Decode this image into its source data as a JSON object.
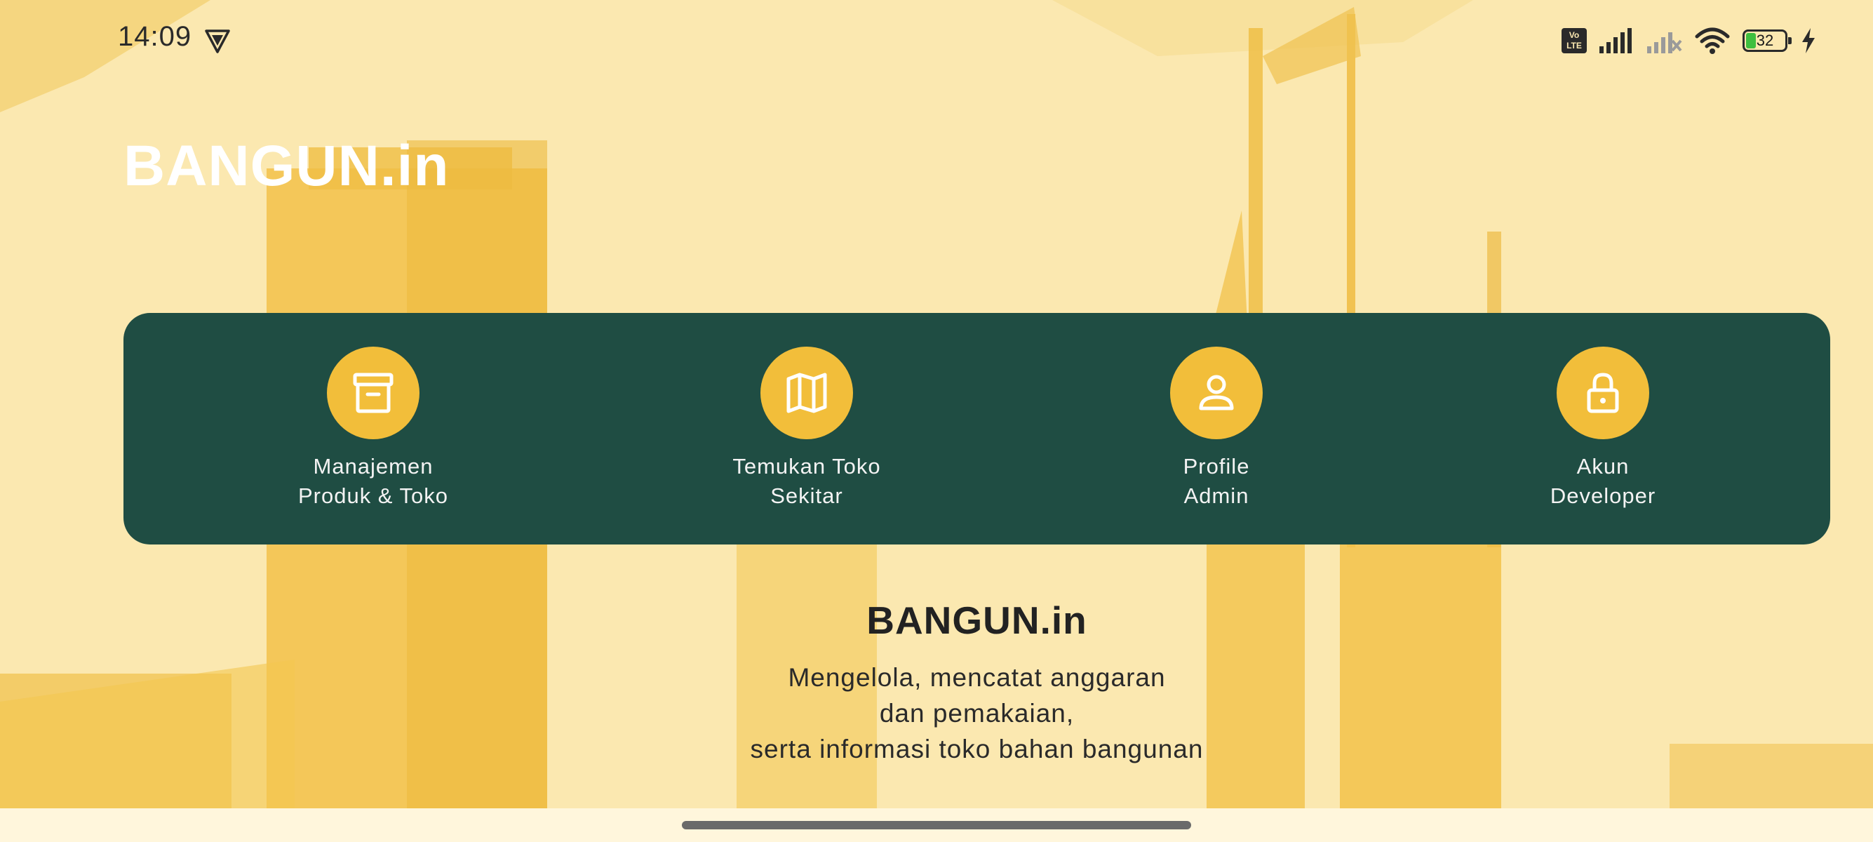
{
  "status_bar": {
    "time": "14:09",
    "volte_label": "Vo LTE",
    "battery_level": "32"
  },
  "app": {
    "title": "BANGUN.in"
  },
  "menu": {
    "items": [
      {
        "line1": "Manajemen",
        "line2": "Produk & Toko",
        "icon": "archive-box-icon"
      },
      {
        "line1": "Temukan Toko",
        "line2": "Sekitar",
        "icon": "map-icon"
      },
      {
        "line1": "Profile",
        "line2": "Admin",
        "icon": "person-icon"
      },
      {
        "line1": "Akun",
        "line2": "Developer",
        "icon": "lock-icon"
      }
    ]
  },
  "info": {
    "title": "BANGUN.in",
    "line1": "Mengelola, mencatat anggaran",
    "line2": "dan pemakaian,",
    "line3": "serta informasi toko bahan bangunan"
  },
  "colors": {
    "background": "#FBE8B0",
    "card": "#1F4D43",
    "accent": "#F2BE3A"
  }
}
